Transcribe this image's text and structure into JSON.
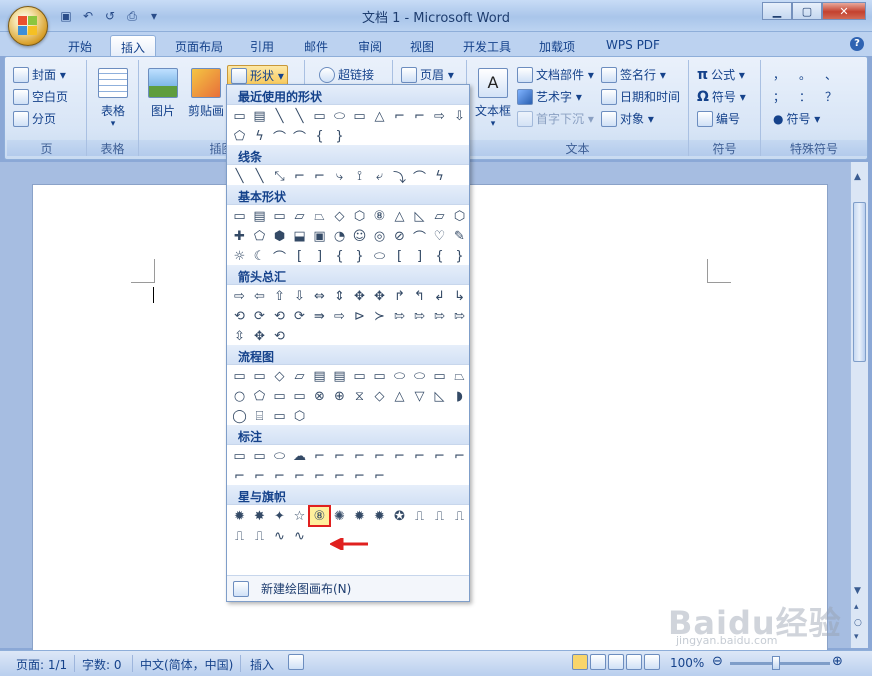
{
  "window": {
    "title": "文档 1 - Microsoft Word",
    "controls": [
      "minimize",
      "maximize",
      "close"
    ],
    "help": "?"
  },
  "tabs": [
    {
      "label": "开始",
      "active": false
    },
    {
      "label": "插入",
      "active": true
    },
    {
      "label": "页面布局",
      "active": false
    },
    {
      "label": "引用",
      "active": false
    },
    {
      "label": "邮件",
      "active": false
    },
    {
      "label": "审阅",
      "active": false
    },
    {
      "label": "视图",
      "active": false
    },
    {
      "label": "开发工具",
      "active": false
    },
    {
      "label": "加载项",
      "active": false
    },
    {
      "label": "WPS PDF",
      "active": false
    }
  ],
  "ribbon": {
    "pages": {
      "label": "页",
      "items": [
        "封面 ▾",
        "空白页",
        "分页"
      ]
    },
    "table": {
      "label": "表格",
      "button": "表格"
    },
    "illustrations": {
      "label": "插图",
      "picture": "图片",
      "clipart": "剪贴画",
      "shapes": "形状 ▾"
    },
    "links": {
      "hyperlink": "超链接"
    },
    "header_footer": {
      "header": "页眉 ▾"
    },
    "text": {
      "label": "文本",
      "textbox": "文本框",
      "quickparts": "文档部件 ▾",
      "wordart": "艺术字 ▾",
      "dropcap": "首字下沉 ▾",
      "signature": "签名行 ▾",
      "datetime": "日期和时间",
      "object": "对象 ▾"
    },
    "symbols": {
      "label": "符号",
      "equation": "公式 ▾",
      "symbol": "符号 ▾",
      "number": "编号"
    },
    "special": {
      "label": "特殊符号",
      "symbol": "符号 ▾",
      "chars": [
        "，",
        "。",
        "、",
        "；",
        "：",
        "？"
      ]
    }
  },
  "shapes_gallery": {
    "sections": [
      {
        "title": "最近使用的形状",
        "rows": [
          [
            "▭",
            "▤",
            "╲",
            "╲",
            "▭",
            "⬭",
            "▭",
            "△",
            "⌐",
            "⌐",
            "⇨",
            "⇩"
          ],
          [
            "⬠",
            "ϟ",
            "⌒",
            "⌒",
            "{",
            "}"
          ]
        ]
      },
      {
        "title": "线条",
        "rows": [
          [
            "╲",
            "╲",
            "⤡",
            "⌐",
            "⌐",
            "⤷",
            "⟟",
            "⤶",
            "⤵",
            "⌒",
            "ϟ"
          ]
        ]
      },
      {
        "title": "基本形状",
        "rows": [
          [
            "▭",
            "▤",
            "▭",
            "▱",
            "⏢",
            "◇",
            "⬡",
            "⑧",
            "△",
            "◺",
            "▱",
            "⬡"
          ],
          [
            "✚",
            "⬠",
            "⬢",
            "⬓",
            "▣",
            "◔",
            "☺",
            "◎",
            "⊘",
            "⌒",
            "♡",
            "✎"
          ],
          [
            "☼",
            "☾",
            "⌒",
            "[",
            "]",
            "{",
            "}",
            "⬭",
            "[",
            "]",
            "{",
            "}"
          ]
        ]
      },
      {
        "title": "箭头总汇",
        "rows": [
          [
            "⇨",
            "⇦",
            "⇧",
            "⇩",
            "⇔",
            "⇕",
            "✥",
            "✥",
            "↱",
            "↰",
            "↲",
            "↳"
          ],
          [
            "⟲",
            "⟳",
            "⟲",
            "⟳",
            "⇛",
            "⇨",
            "⊳",
            "≻",
            "⇰",
            "⇰",
            "⇰",
            "⇰"
          ],
          [
            "⇳",
            "✥",
            "⟲"
          ]
        ]
      },
      {
        "title": "流程图",
        "rows": [
          [
            "▭",
            "▭",
            "◇",
            "▱",
            "▤",
            "▤",
            "▭",
            "▭",
            "⬭",
            "⬭",
            "▭",
            "⏢"
          ],
          [
            "○",
            "⬠",
            "▭",
            "▭",
            "⊗",
            "⊕",
            "⧖",
            "◇",
            "△",
            "▽",
            "◺",
            "◗"
          ],
          [
            "◯",
            "⌸",
            "▭",
            "⬡"
          ]
        ]
      },
      {
        "title": "标注",
        "rows": [
          [
            "▭",
            "▭",
            "⬭",
            "☁",
            "⌐",
            "⌐",
            "⌐",
            "⌐",
            "⌐",
            "⌐",
            "⌐",
            "⌐"
          ],
          [
            "⌐",
            "⌐",
            "⌐",
            "⌐",
            "⌐",
            "⌐",
            "⌐",
            "⌐"
          ]
        ]
      },
      {
        "title": "星与旗帜",
        "rows": [
          [
            "✹",
            "✸",
            "✦",
            "☆",
            "⑧",
            "✺",
            "✹",
            "✹",
            "✪",
            "⎍",
            "⎍",
            "⎍"
          ],
          [
            "⎍",
            "⎍",
            "∿",
            "∿"
          ]
        ]
      }
    ],
    "selected": "⑧",
    "footer": "新建绘图画布(N)"
  },
  "status": {
    "page": "页面: 1/1",
    "words": "字数: 0",
    "language": "中文(简体，中国)",
    "mode": "插入",
    "zoom": "100%"
  },
  "watermark": {
    "text": "Baidu经验",
    "sub": "jingyan.baidu.com"
  }
}
